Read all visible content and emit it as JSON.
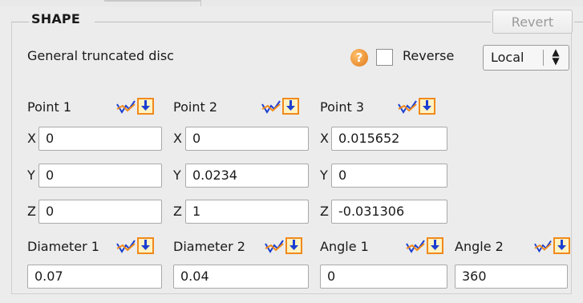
{
  "section": {
    "title": "SHAPE",
    "revert_label": "Revert"
  },
  "shape_type": "General truncated disc",
  "controls": {
    "help_glyph": "?",
    "reverse_label": "Reverse",
    "reverse_checked": false,
    "frame_select": {
      "value": "Local",
      "arrows": "▲▼"
    }
  },
  "points": [
    {
      "label": "Point 1",
      "x": "0",
      "y": "0",
      "z": "0"
    },
    {
      "label": "Point 2",
      "x": "0",
      "y": "0.0234",
      "z": "1"
    },
    {
      "label": "Point 3",
      "x": "0.015652",
      "y": "0",
      "z": "-0.031306"
    }
  ],
  "axes": {
    "x": "X",
    "y": "Y",
    "z": "Z"
  },
  "params": [
    {
      "label": "Diameter 1",
      "value": "0.07"
    },
    {
      "label": "Diameter 2",
      "value": "0.04"
    },
    {
      "label": "Angle 1",
      "value": "0"
    },
    {
      "label": "Angle 2",
      "value": "360"
    }
  ],
  "icons": {
    "graph": "curve-graph-icon",
    "pick": "pick-down-arrow-icon"
  },
  "colors": {
    "icon_blue": "#1a3fd1",
    "icon_orange": "#f08a1c",
    "revert_disabled": "#9a9a9a"
  }
}
